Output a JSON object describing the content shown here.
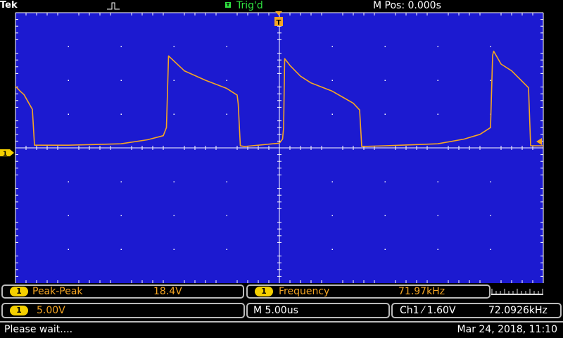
{
  "header": {
    "brand": "Tek",
    "trigger_status": "Trig'd",
    "trigger_marker": "T",
    "position": "M Pos: 0.000s"
  },
  "channel": {
    "marker": "1",
    "color": "#f5a623",
    "badge_color": "#f5d000"
  },
  "chart_data": {
    "type": "line",
    "title": "",
    "xlabel": "",
    "ylabel": "",
    "grid": true,
    "x_divisions": 10,
    "y_divisions": 8,
    "xlim": [
      -25,
      25
    ],
    "ylim": [
      -20,
      20
    ],
    "x_unit": "us",
    "y_unit": "V",
    "series": [
      {
        "x": [
          -25,
          -24.5,
          -24.2,
          -23.4,
          -23.2,
          -20,
          -15,
          -12.5,
          -11,
          -10.7,
          -10.5,
          -9,
          -7,
          -5,
          -4,
          -3.9,
          -3.7,
          -3.3,
          0,
          0.3,
          0.4,
          0.5,
          1,
          2,
          3,
          5,
          6,
          7,
          7.6,
          7.8,
          10,
          15,
          17.5,
          19,
          20,
          20.2,
          20.3,
          21,
          22,
          23.6,
          23.8,
          25
        ],
        "y": [
          9.1,
          8.3,
          7.9,
          5.7,
          0.4,
          0.4,
          0.6,
          1.2,
          1.8,
          3,
          13.6,
          11.4,
          10,
          8.8,
          7.8,
          6.5,
          0.3,
          0.2,
          0.7,
          1.3,
          3,
          13.2,
          12.2,
          10.6,
          9.6,
          8.4,
          7.5,
          6.6,
          5.6,
          0.2,
          0.3,
          0.6,
          1.3,
          2,
          3,
          13.7,
          14.3,
          12.4,
          11.4,
          8.9,
          0.3,
          0.3
        ]
      }
    ]
  },
  "measurements": {
    "m1": {
      "channel": "1",
      "label": "Peak-Peak",
      "value": "18.4V"
    },
    "m2": {
      "channel": "1",
      "label": "Frequency",
      "value": "71.97kHz"
    }
  },
  "settings": {
    "channel": "1",
    "volts_per_div": "5.00V",
    "timebase": "M 5.00us",
    "trigger": "Ch1 ⁄ 1.60V",
    "trigger_freq": "72.0926kHz"
  },
  "status": {
    "message": "Please wait....",
    "datetime": "Mar 24, 2018, 11:10"
  }
}
